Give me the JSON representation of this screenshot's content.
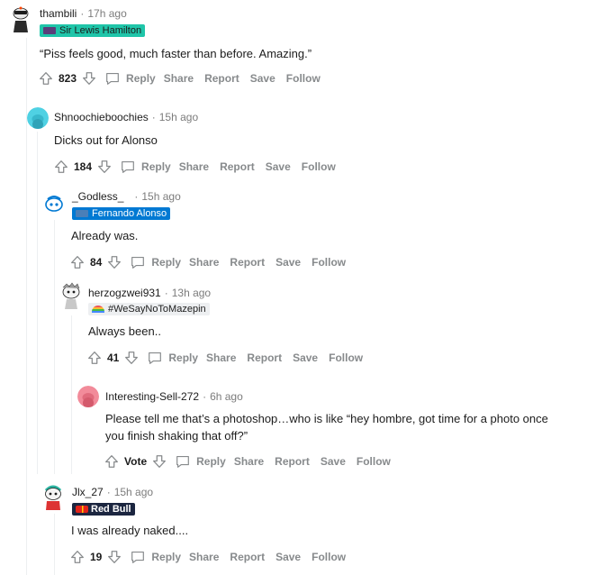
{
  "comments": [
    {
      "author": "thambili",
      "time": "17h ago",
      "flair": "Sir Lewis Hamilton",
      "flair_bg": "#1fc5a9",
      "flair_color": "#1c1c1c",
      "body": "“Piss feels good, much faster than before. Amazing.”",
      "score": "823",
      "avatar_color": "#ffffff"
    },
    {
      "author": "Shnoochieboochies",
      "time": "15h ago",
      "flair": "",
      "body": "Dicks out for Alonso",
      "score": "184",
      "avatar_color": "#4fd1e3"
    },
    {
      "author": "_Godless_",
      "time": "15h ago",
      "flair": "Fernando Alonso",
      "flair_bg": "#0079d3",
      "flair_color": "#ffffff",
      "body": "Already was.",
      "score": "84",
      "avatar_color": "#ffffff"
    },
    {
      "author": "herzogzwei931",
      "time": "13h ago",
      "flair": "#WeSayNoToMazepin",
      "flair_bg": "#edeff1",
      "flair_color": "#1c1c1c",
      "body": "Always been..",
      "score": "41",
      "avatar_color": "#ffffff"
    },
    {
      "author": "Interesting-Sell-272",
      "time": "6h ago",
      "flair": "",
      "body_line1": "Please tell me that’s a photoshop…who is like “hey hombre, got time for a photo once",
      "body_line2": "you finish shaking that off?”",
      "score": "Vote",
      "avatar_color": "#f28b9a"
    },
    {
      "author": "Jlx_27",
      "time": "15h ago",
      "flair": "Red Bull",
      "flair_bg": "#1c2640",
      "flair_color": "#ffffff",
      "body": "I was already naked....",
      "score": "19",
      "avatar_color": "#ffffff"
    }
  ],
  "actions": {
    "reply": "Reply",
    "share": "Share",
    "report": "Report",
    "save": "Save",
    "follow": "Follow"
  },
  "separator": "·"
}
